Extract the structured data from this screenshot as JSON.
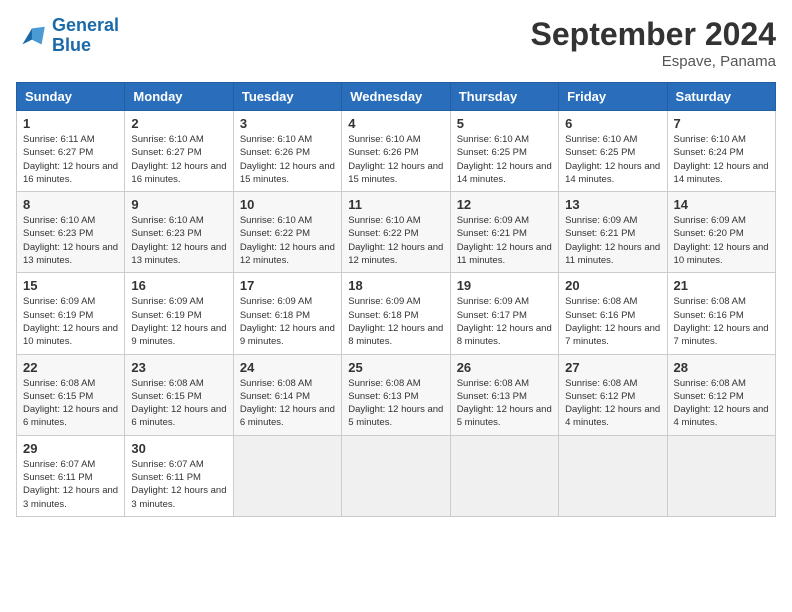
{
  "logo": {
    "line1": "General",
    "line2": "Blue"
  },
  "title": "September 2024",
  "subtitle": "Espave, Panama",
  "days_of_week": [
    "Sunday",
    "Monday",
    "Tuesday",
    "Wednesday",
    "Thursday",
    "Friday",
    "Saturday"
  ],
  "weeks": [
    [
      {
        "day": 1,
        "sunrise": "6:11 AM",
        "sunset": "6:27 PM",
        "daylight": "12 hours and 16 minutes."
      },
      {
        "day": 2,
        "sunrise": "6:10 AM",
        "sunset": "6:27 PM",
        "daylight": "12 hours and 16 minutes."
      },
      {
        "day": 3,
        "sunrise": "6:10 AM",
        "sunset": "6:26 PM",
        "daylight": "12 hours and 15 minutes."
      },
      {
        "day": 4,
        "sunrise": "6:10 AM",
        "sunset": "6:26 PM",
        "daylight": "12 hours and 15 minutes."
      },
      {
        "day": 5,
        "sunrise": "6:10 AM",
        "sunset": "6:25 PM",
        "daylight": "12 hours and 14 minutes."
      },
      {
        "day": 6,
        "sunrise": "6:10 AM",
        "sunset": "6:25 PM",
        "daylight": "12 hours and 14 minutes."
      },
      {
        "day": 7,
        "sunrise": "6:10 AM",
        "sunset": "6:24 PM",
        "daylight": "12 hours and 14 minutes."
      }
    ],
    [
      {
        "day": 8,
        "sunrise": "6:10 AM",
        "sunset": "6:23 PM",
        "daylight": "12 hours and 13 minutes."
      },
      {
        "day": 9,
        "sunrise": "6:10 AM",
        "sunset": "6:23 PM",
        "daylight": "12 hours and 13 minutes."
      },
      {
        "day": 10,
        "sunrise": "6:10 AM",
        "sunset": "6:22 PM",
        "daylight": "12 hours and 12 minutes."
      },
      {
        "day": 11,
        "sunrise": "6:10 AM",
        "sunset": "6:22 PM",
        "daylight": "12 hours and 12 minutes."
      },
      {
        "day": 12,
        "sunrise": "6:09 AM",
        "sunset": "6:21 PM",
        "daylight": "12 hours and 11 minutes."
      },
      {
        "day": 13,
        "sunrise": "6:09 AM",
        "sunset": "6:21 PM",
        "daylight": "12 hours and 11 minutes."
      },
      {
        "day": 14,
        "sunrise": "6:09 AM",
        "sunset": "6:20 PM",
        "daylight": "12 hours and 10 minutes."
      }
    ],
    [
      {
        "day": 15,
        "sunrise": "6:09 AM",
        "sunset": "6:19 PM",
        "daylight": "12 hours and 10 minutes."
      },
      {
        "day": 16,
        "sunrise": "6:09 AM",
        "sunset": "6:19 PM",
        "daylight": "12 hours and 9 minutes."
      },
      {
        "day": 17,
        "sunrise": "6:09 AM",
        "sunset": "6:18 PM",
        "daylight": "12 hours and 9 minutes."
      },
      {
        "day": 18,
        "sunrise": "6:09 AM",
        "sunset": "6:18 PM",
        "daylight": "12 hours and 8 minutes."
      },
      {
        "day": 19,
        "sunrise": "6:09 AM",
        "sunset": "6:17 PM",
        "daylight": "12 hours and 8 minutes."
      },
      {
        "day": 20,
        "sunrise": "6:08 AM",
        "sunset": "6:16 PM",
        "daylight": "12 hours and 7 minutes."
      },
      {
        "day": 21,
        "sunrise": "6:08 AM",
        "sunset": "6:16 PM",
        "daylight": "12 hours and 7 minutes."
      }
    ],
    [
      {
        "day": 22,
        "sunrise": "6:08 AM",
        "sunset": "6:15 PM",
        "daylight": "12 hours and 6 minutes."
      },
      {
        "day": 23,
        "sunrise": "6:08 AM",
        "sunset": "6:15 PM",
        "daylight": "12 hours and 6 minutes."
      },
      {
        "day": 24,
        "sunrise": "6:08 AM",
        "sunset": "6:14 PM",
        "daylight": "12 hours and 6 minutes."
      },
      {
        "day": 25,
        "sunrise": "6:08 AM",
        "sunset": "6:13 PM",
        "daylight": "12 hours and 5 minutes."
      },
      {
        "day": 26,
        "sunrise": "6:08 AM",
        "sunset": "6:13 PM",
        "daylight": "12 hours and 5 minutes."
      },
      {
        "day": 27,
        "sunrise": "6:08 AM",
        "sunset": "6:12 PM",
        "daylight": "12 hours and 4 minutes."
      },
      {
        "day": 28,
        "sunrise": "6:08 AM",
        "sunset": "6:12 PM",
        "daylight": "12 hours and 4 minutes."
      }
    ],
    [
      {
        "day": 29,
        "sunrise": "6:07 AM",
        "sunset": "6:11 PM",
        "daylight": "12 hours and 3 minutes."
      },
      {
        "day": 30,
        "sunrise": "6:07 AM",
        "sunset": "6:11 PM",
        "daylight": "12 hours and 3 minutes."
      },
      null,
      null,
      null,
      null,
      null
    ]
  ]
}
